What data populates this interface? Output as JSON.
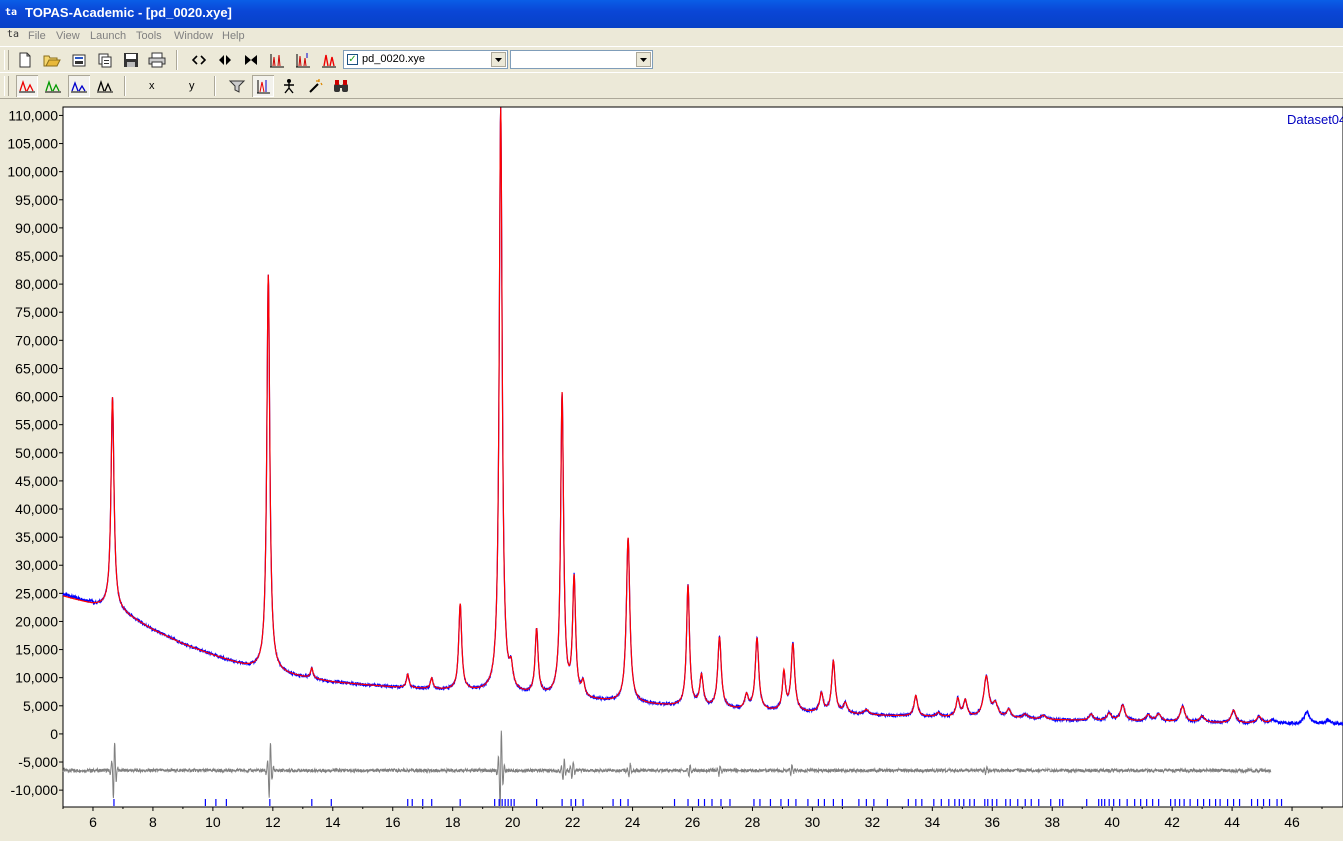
{
  "window": {
    "title": "TOPAS-Academic - [pd_0020.xye]",
    "app_icon": "topas-app-icon"
  },
  "menu": {
    "items": [
      "File",
      "View",
      "Launch",
      "Tools",
      "Window",
      "Help"
    ]
  },
  "toolbar1": {
    "icons": [
      "new-file-icon",
      "open-folder-icon",
      "open-project-icon",
      "copy-icon",
      "save-icon",
      "print-icon",
      "fit-horizontal-icon",
      "arrow-left-right-icon",
      "arrow-collapse-icon",
      "chart-peaks-icon",
      "chart-peaks-alt-icon",
      "chart-peaks-red-icon"
    ],
    "file_combo": {
      "value": "pd_0020.xye",
      "checked": true
    },
    "second_combo": {
      "value": ""
    }
  },
  "toolbar2": {
    "icons": [
      "peaks-red-icon",
      "peaks-green-icon",
      "peaks-blue-icon",
      "peaks-black-icon",
      "filter-icon",
      "peak-select-icon",
      "figure-icon",
      "magic-wand-icon",
      "binoculars-icon"
    ],
    "x_label": "x",
    "y_label": "y"
  },
  "chart_data": {
    "type": "line",
    "dataset_label": "Dataset04",
    "xlim": [
      5.0,
      47.7
    ],
    "ylim": [
      -13000,
      111500
    ],
    "x_ticks": [
      6,
      8,
      10,
      12,
      14,
      16,
      18,
      20,
      22,
      24,
      26,
      28,
      30,
      32,
      34,
      36,
      38,
      40,
      42,
      44,
      46
    ],
    "y_ticks": [
      110000,
      105000,
      100000,
      95000,
      90000,
      85000,
      80000,
      75000,
      70000,
      65000,
      60000,
      55000,
      50000,
      45000,
      40000,
      35000,
      30000,
      25000,
      20000,
      15000,
      10000,
      5000,
      0,
      -5000,
      -10000
    ],
    "y_tick_labels": [
      "110,000",
      "105,000",
      "100,000",
      "95,000",
      "90,000",
      "85,000",
      "80,000",
      "75,000",
      "70,000",
      "65,000",
      "60,000",
      "55,000",
      "50,000",
      "45,000",
      "40,000",
      "35,000",
      "30,000",
      "25,000",
      "20,000",
      "15,000",
      "10,000",
      "5,000",
      "0",
      "-5,000",
      "-10,000"
    ],
    "grid": false,
    "series": [
      {
        "role": "observed",
        "color": "#0000ff"
      },
      {
        "role": "calculated",
        "color": "#ff0000"
      },
      {
        "role": "difference",
        "color": "#808080",
        "offset": -6500
      }
    ],
    "background": [
      [
        5.0,
        24500
      ],
      [
        6.0,
        23000
      ],
      [
        6.6,
        22500
      ],
      [
        7.0,
        21500
      ],
      [
        8.0,
        18500
      ],
      [
        9.0,
        16000
      ],
      [
        10.0,
        14000
      ],
      [
        11.0,
        12200
      ],
      [
        11.7,
        11300
      ],
      [
        12.5,
        10500
      ],
      [
        14.0,
        9200
      ],
      [
        16.0,
        8300
      ],
      [
        18.0,
        7700
      ],
      [
        20.0,
        7000
      ],
      [
        22.0,
        6200
      ],
      [
        24.0,
        5400
      ],
      [
        26.0,
        4700
      ],
      [
        28.0,
        4100
      ],
      [
        30.0,
        3700
      ],
      [
        32.0,
        3300
      ],
      [
        34.0,
        3000
      ],
      [
        36.0,
        2800
      ],
      [
        38.0,
        2500
      ],
      [
        40.0,
        2300
      ],
      [
        42.0,
        2100
      ],
      [
        44.0,
        1900
      ],
      [
        46.0,
        1800
      ],
      [
        47.7,
        1700
      ]
    ],
    "peaks": [
      [
        6.65,
        37500,
        0.06
      ],
      [
        11.85,
        70500,
        0.06
      ],
      [
        13.3,
        1800,
        0.05
      ],
      [
        16.5,
        2400,
        0.05
      ],
      [
        17.3,
        1900,
        0.05
      ],
      [
        18.25,
        15300,
        0.06
      ],
      [
        19.6,
        104000,
        0.06
      ],
      [
        19.95,
        3500,
        0.07
      ],
      [
        20.8,
        11500,
        0.06
      ],
      [
        21.65,
        53800,
        0.06
      ],
      [
        22.05,
        20800,
        0.06
      ],
      [
        22.35,
        2500,
        0.06
      ],
      [
        23.85,
        29300,
        0.07
      ],
      [
        25.85,
        21500,
        0.06
      ],
      [
        26.3,
        5500,
        0.07
      ],
      [
        26.9,
        12600,
        0.07
      ],
      [
        27.8,
        2500,
        0.07
      ],
      [
        28.15,
        12800,
        0.07
      ],
      [
        29.05,
        6800,
        0.06
      ],
      [
        29.35,
        11900,
        0.07
      ],
      [
        30.3,
        3400,
        0.07
      ],
      [
        30.7,
        9200,
        0.07
      ],
      [
        31.1,
        1800,
        0.08
      ],
      [
        31.8,
        900,
        0.1
      ],
      [
        33.45,
        3700,
        0.07
      ],
      [
        34.2,
        700,
        0.08
      ],
      [
        34.85,
        3200,
        0.07
      ],
      [
        35.1,
        2900,
        0.07
      ],
      [
        35.8,
        7200,
        0.1
      ],
      [
        36.1,
        2300,
        0.1
      ],
      [
        36.55,
        1500,
        0.08
      ],
      [
        37.1,
        800,
        0.1
      ],
      [
        37.7,
        700,
        0.1
      ],
      [
        39.3,
        1100,
        0.08
      ],
      [
        39.9,
        1300,
        0.09
      ],
      [
        40.35,
        2800,
        0.09
      ],
      [
        41.2,
        1100,
        0.1
      ],
      [
        41.55,
        1300,
        0.1
      ],
      [
        42.35,
        2800,
        0.09
      ],
      [
        43.0,
        1100,
        0.1
      ],
      [
        44.05,
        2300,
        0.09
      ],
      [
        44.9,
        1200,
        0.1
      ],
      [
        45.35,
        700,
        0.1
      ],
      [
        46.5,
        2100,
        0.1
      ],
      [
        47.2,
        700,
        0.1
      ]
    ],
    "calc_end": 45.3,
    "difference_spikes": [
      [
        6.7,
        4000
      ],
      [
        11.9,
        4000
      ],
      [
        19.6,
        5500
      ],
      [
        21.7,
        1500
      ],
      [
        22.0,
        1200
      ],
      [
        23.9,
        900
      ],
      [
        25.9,
        900
      ],
      [
        26.9,
        700
      ],
      [
        29.3,
        900
      ],
      [
        35.8,
        600
      ]
    ],
    "reflection_ticks": [
      6.7,
      9.75,
      10.1,
      10.45,
      11.9,
      13.3,
      13.95,
      16.5,
      16.65,
      17.0,
      17.3,
      18.25,
      19.4,
      19.55,
      19.65,
      19.75,
      19.85,
      19.95,
      20.05,
      20.8,
      21.65,
      21.95,
      22.1,
      22.35,
      23.35,
      23.6,
      23.85,
      25.4,
      25.85,
      26.2,
      26.4,
      26.65,
      26.95,
      27.25,
      28.05,
      28.25,
      28.6,
      28.95,
      29.2,
      29.45,
      29.85,
      30.2,
      30.4,
      30.7,
      31.0,
      31.55,
      31.8,
      32.05,
      32.5,
      33.2,
      33.45,
      33.65,
      34.05,
      34.3,
      34.55,
      34.75,
      34.9,
      35.05,
      35.25,
      35.4,
      35.75,
      35.85,
      36.0,
      36.15,
      36.45,
      36.6,
      36.85,
      37.1,
      37.3,
      37.55,
      37.95,
      38.25,
      38.35,
      39.15,
      39.55,
      39.65,
      39.75,
      39.9,
      40.05,
      40.25,
      40.5,
      40.75,
      40.95,
      41.15,
      41.35,
      41.55,
      41.95,
      42.1,
      42.25,
      42.4,
      42.6,
      42.85,
      43.05,
      43.25,
      43.45,
      43.6,
      43.85,
      44.05,
      44.25,
      44.65,
      44.85,
      45.05,
      45.25,
      45.5,
      45.65
    ]
  }
}
